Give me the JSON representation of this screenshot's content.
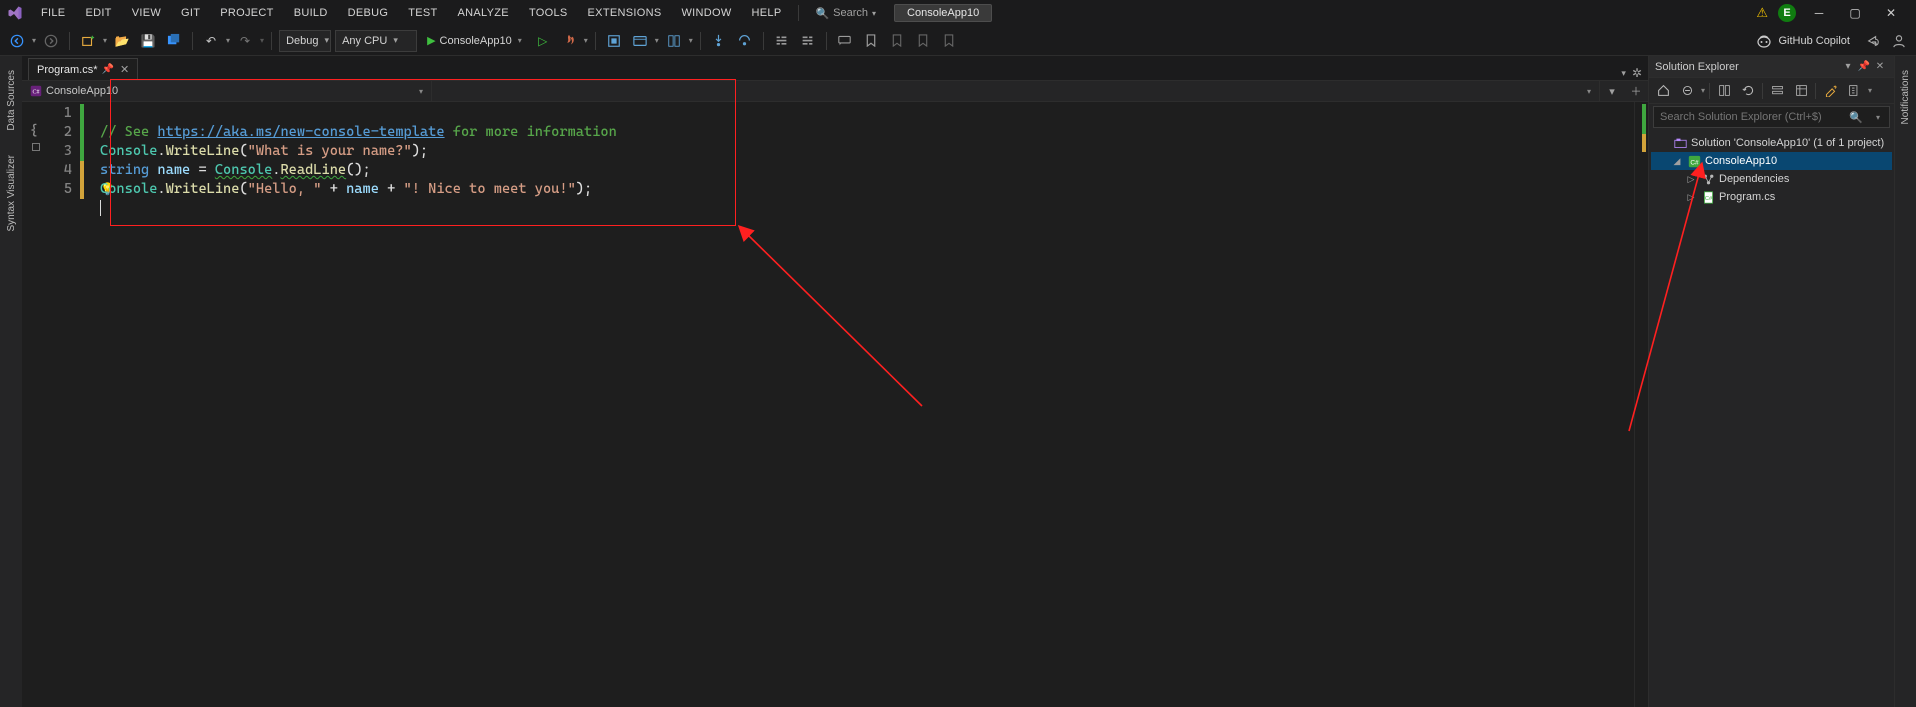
{
  "menu": {
    "items": [
      "FILE",
      "EDIT",
      "VIEW",
      "GIT",
      "PROJECT",
      "BUILD",
      "DEBUG",
      "TEST",
      "ANALYZE",
      "TOOLS",
      "EXTENSIONS",
      "WINDOW",
      "HELP"
    ],
    "search_label": "Search",
    "title_chip": "ConsoleApp10",
    "user_initial": "E"
  },
  "toolbar": {
    "config": "Debug",
    "platform": "Any CPU",
    "start_label": "ConsoleApp10",
    "copilot_label": "GitHub Copilot"
  },
  "tabs": {
    "file_tab": "Program.cs*"
  },
  "navbar": {
    "project": "ConsoleApp10"
  },
  "left_strip": {
    "labels": [
      "Data Sources",
      "Syntax Visualizer"
    ]
  },
  "right_strip": {
    "labels": [
      "Notifications"
    ]
  },
  "editor": {
    "lines": [
      "1",
      "2",
      "3",
      "4",
      "5"
    ],
    "code": {
      "l1_prefix": "// See ",
      "l1_link": "https://aka.ms/new-console-template",
      "l1_suffix": " for more information",
      "l2_a": "Console",
      "l2_b": ".",
      "l2_c": "WriteLine",
      "l2_d": "(",
      "l2_e": "\"What is your name?\"",
      "l2_f": ");",
      "l3_a": "string",
      "l3_b": " ",
      "l3_c": "name",
      "l3_d": " = ",
      "l3_e": "Console",
      "l3_f": ".",
      "l3_g": "ReadLine",
      "l3_h": "();",
      "l4_a": "Console",
      "l4_b": ".",
      "l4_c": "WriteLine",
      "l4_d": "(",
      "l4_e": "\"Hello, \"",
      "l4_f": " + ",
      "l4_g": "name",
      "l4_h": " + ",
      "l4_i": "\"! Nice to meet you!\"",
      "l4_j": ");"
    },
    "brace_glyph": "{"
  },
  "solution_explorer": {
    "title": "Solution Explorer",
    "search_placeholder": "Search Solution Explorer (Ctrl+$)",
    "solution_label": "Solution 'ConsoleApp10' (1 of 1 project)",
    "project_label": "ConsoleApp10",
    "dependencies_label": "Dependencies",
    "program_label": "Program.cs"
  }
}
